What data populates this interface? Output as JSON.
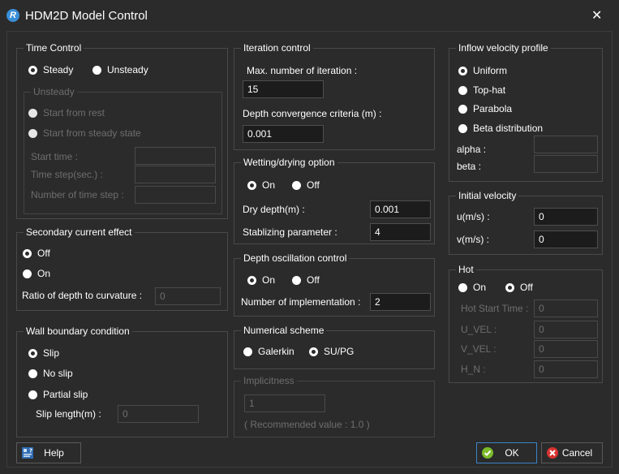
{
  "window": {
    "title": "HDM2D Model Control",
    "app_icon_letter": "R"
  },
  "time_control": {
    "title": "Time Control",
    "steady": "Steady",
    "unsteady": "Unsteady",
    "unsteady_group": {
      "title": "Unsteady",
      "start_from_rest": "Start from rest",
      "start_from_steady": "Start from steady state",
      "start_time_label": "Start time :",
      "time_step_label": "Time step(sec.) :",
      "num_time_step_label": "Number of time step :",
      "start_time_value": "",
      "time_step_value": "",
      "num_time_step_value": ""
    }
  },
  "secondary_current": {
    "title": "Secondary current effect",
    "off": "Off",
    "on": "On",
    "ratio_label": "Ratio of depth to curvature :",
    "ratio_value": "0"
  },
  "wall_boundary": {
    "title": "Wall boundary condition",
    "slip": "Slip",
    "no_slip": "No slip",
    "partial_slip": "Partial slip",
    "slip_length_label": "Slip length(m) :",
    "slip_length_value": "0"
  },
  "iteration_control": {
    "title": "Iteration control",
    "max_iter_label": "Max. number of iteration :",
    "max_iter_value": "15",
    "depth_conv_label": "Depth convergence criteria (m) :",
    "depth_conv_value": "0.001"
  },
  "wetting_drying": {
    "title": "Wetting/drying option",
    "on": "On",
    "off": "Off",
    "dry_depth_label": "Dry depth(m) :",
    "dry_depth_value": "0.001",
    "stab_label": "Stablizing parameter :",
    "stab_value": "4"
  },
  "depth_oscillation": {
    "title": "Depth oscillation control",
    "on": "On",
    "off": "Off",
    "num_impl_label": "Number of implementation :",
    "num_impl_value": "2"
  },
  "numerical_scheme": {
    "title": "Numerical scheme",
    "galerkin": "Galerkin",
    "supg": "SU/PG"
  },
  "implicitness": {
    "title": "Implicitness",
    "value": "1",
    "note": "( Recommended value : 1.0 )"
  },
  "inflow_profile": {
    "title": "Inflow velocity profile",
    "uniform": "Uniform",
    "top_hat": "Top-hat",
    "parabola": "Parabola",
    "beta_dist": "Beta distribution",
    "alpha_label": "alpha :",
    "beta_label": "beta :",
    "alpha_value": "",
    "beta_value": ""
  },
  "initial_velocity": {
    "title": "Initial velocity",
    "u_label": "u(m/s) :",
    "u_value": "0",
    "v_label": "v(m/s) :",
    "v_value": "0"
  },
  "hot": {
    "title": "Hot",
    "on": "On",
    "off": "Off",
    "start_time_label": "Hot Start Time :",
    "start_time_value": "0",
    "u_vel_label": "U_VEL :",
    "u_vel_value": "0",
    "v_vel_label": "V_VEL :",
    "v_vel_value": "0",
    "h_n_label": "H_N :",
    "h_n_value": "0"
  },
  "buttons": {
    "help": "Help",
    "ok": "OK",
    "cancel": "Cancel"
  },
  "colors": {
    "background": "#2b2b2b",
    "border": "#4a4a4a",
    "disabled_text": "#6e6e6e",
    "ok_border": "#3c82c8"
  }
}
